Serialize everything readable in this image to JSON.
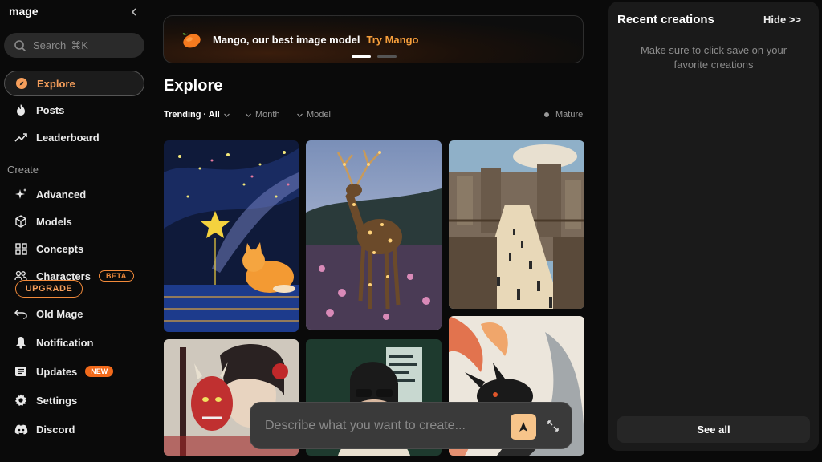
{
  "app": {
    "logo": "mage"
  },
  "search": {
    "label": "Search",
    "shortcut": "⌘K"
  },
  "nav": {
    "explore": "Explore",
    "posts": "Posts",
    "leaderboard": "Leaderboard",
    "create_label": "Create",
    "advanced": "Advanced",
    "models": "Models",
    "concepts": "Concepts",
    "characters": "Characters",
    "characters_badge": "BETA",
    "upgrade": "UPGRADE",
    "old_mage": "Old Mage",
    "notification": "Notification",
    "updates": "Updates",
    "updates_badge": "NEW",
    "settings": "Settings",
    "discord": "Discord"
  },
  "banner": {
    "text": "Mango, our best image model",
    "link": "Try Mango"
  },
  "main": {
    "title": "Explore",
    "filters": {
      "trending": "Trending · All",
      "month": "Month",
      "model": "Model",
      "mature": "Mature"
    }
  },
  "prompt": {
    "placeholder": "Describe what you want to create..."
  },
  "recent": {
    "title": "Recent creations",
    "hide": "Hide >>",
    "hint": "Make sure to click save on your favorite creations",
    "see_all": "See all"
  },
  "colors": {
    "accent": "#f59e5b",
    "orange": "#f28a3a",
    "bg": "#0a0a0a",
    "panel": "#1a1a1a"
  }
}
